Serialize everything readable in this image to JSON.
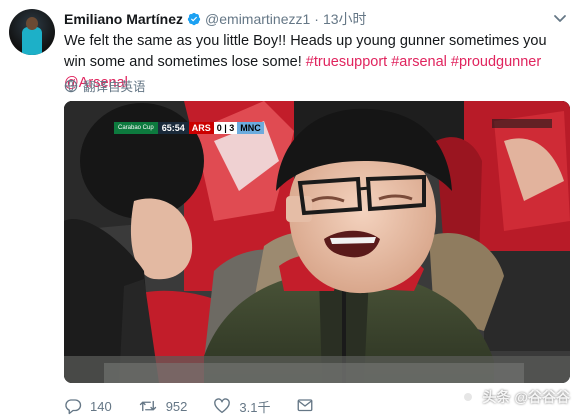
{
  "tweet": {
    "author_name": "Emiliano Martínez",
    "handle": "@emimartinezz1",
    "separator": "·",
    "time": "13小时",
    "text_plain": "We felt the same as you little Boy!! Heads up young gunner sometimes you win some and sometimes lose some!",
    "hashtags": [
      "#truesupport",
      "#arsenal",
      "#proudgunner"
    ],
    "mention": "@Arsenal",
    "translate_label": "翻译自英语"
  },
  "scorebug": {
    "competition": "Carabao Cup",
    "clock": "65:54",
    "home": "ARS",
    "score": "0 | 3",
    "away": "MNC"
  },
  "actions": {
    "replies": "140",
    "retweets": "952",
    "likes": "3.1千"
  },
  "watermark": "头条 @谷谷谷",
  "colors": {
    "hashtag": "#e0245e",
    "secondary_text": "#657786",
    "verified": "#1da1f2",
    "arsenal_red": "#cc1f2e"
  },
  "icons": [
    "verified-badge-icon",
    "chevron-down-icon",
    "translate-icon",
    "reply-icon",
    "retweet-icon",
    "like-icon",
    "share-icon"
  ]
}
